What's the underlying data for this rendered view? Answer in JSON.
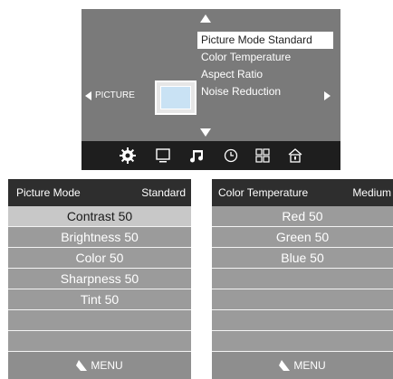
{
  "osd": {
    "menu_items": [
      {
        "label": "Picture Mode Standard"
      },
      {
        "label": "Color Temperature"
      },
      {
        "label": "Aspect Ratio"
      },
      {
        "label": "Noise Reduction"
      }
    ],
    "category_label": "PICTURE",
    "icons": [
      "gear-icon",
      "monitor-icon",
      "music-note-icon",
      "clock-icon",
      "grid-icon",
      "lock-icon"
    ]
  },
  "picture_panel": {
    "title": "Picture Mode",
    "value": "Standard",
    "rows": [
      "Contrast 50",
      "Brightness 50",
      "Color 50",
      "Sharpness 50",
      "Tint 50",
      "",
      ""
    ],
    "footer": "MENU"
  },
  "color_panel": {
    "title": "Color Temperature",
    "value": "Medium",
    "rows": [
      "Red 50",
      "Green 50",
      "Blue 50",
      "",
      "",
      "",
      ""
    ],
    "footer": "MENU"
  }
}
